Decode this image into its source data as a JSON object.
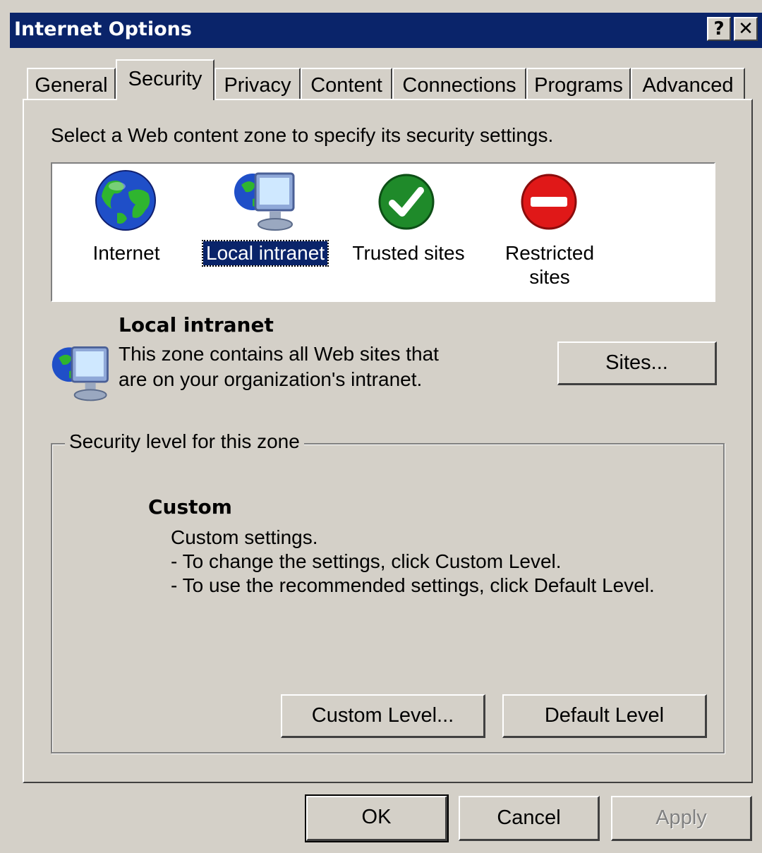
{
  "window": {
    "title": "Internet Options",
    "help_button": "?",
    "close_button": "✕"
  },
  "tabs": [
    {
      "label": "General"
    },
    {
      "label": "Security",
      "active": true
    },
    {
      "label": "Privacy"
    },
    {
      "label": "Content"
    },
    {
      "label": "Connections"
    },
    {
      "label": "Programs"
    },
    {
      "label": "Advanced"
    }
  ],
  "security": {
    "instruction": "Select a Web content zone to specify its security settings.",
    "zones": [
      {
        "label": "Internet",
        "icon": "globe-icon"
      },
      {
        "label": "Local intranet",
        "icon": "intranet-computer-icon",
        "selected": true
      },
      {
        "label": "Trusted sites",
        "icon": "checkmark-icon"
      },
      {
        "label": "Restricted sites",
        "label_line1": "Restricted",
        "label_line2": "sites",
        "icon": "no-entry-icon"
      }
    ],
    "selected_zone": {
      "name": "Local intranet",
      "description_line1": "This zone contains all Web sites that",
      "description_line2": "are on your organization's intranet.",
      "icon": "intranet-computer-icon"
    },
    "sites_button": "Sites...",
    "security_level": {
      "group_label": "Security level for this zone",
      "level_name": "Custom",
      "details": [
        "Custom settings.",
        "- To change the settings, click Custom Level.",
        "- To use the recommended settings, click Default Level."
      ]
    },
    "custom_level_button": "Custom Level...",
    "default_level_button": "Default Level"
  },
  "footer": {
    "ok": "OK",
    "cancel": "Cancel",
    "apply": "Apply"
  },
  "colors": {
    "titlebar": "#0a246a",
    "face": "#d4d0c8",
    "selection": "#0a246a"
  }
}
